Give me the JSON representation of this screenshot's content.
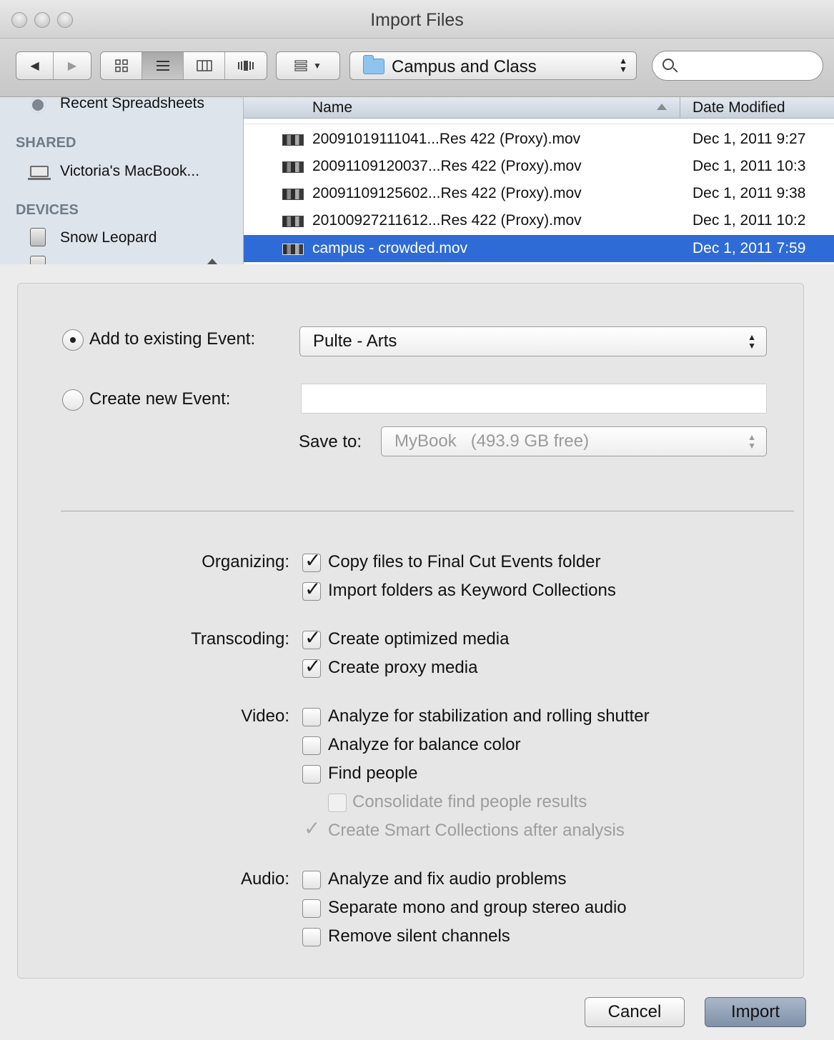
{
  "window": {
    "title": "Import Files"
  },
  "toolbar": {
    "back_icon": "back-arrow-icon",
    "forward_icon": "forward-arrow-icon",
    "views": [
      "icon-view",
      "list-view",
      "column-view",
      "coverflow-view"
    ],
    "active_view": "list-view",
    "location": "Campus and Class",
    "search": {
      "value": "",
      "placeholder": ""
    }
  },
  "sidebar": {
    "items": [
      {
        "label": "Recent Spreadsheets",
        "icon": "gear-icon"
      },
      {
        "label": "SHARED",
        "type": "header"
      },
      {
        "label": "Victoria's MacBook...",
        "icon": "laptop-icon"
      },
      {
        "label": "DEVICES",
        "type": "header"
      },
      {
        "label": "Snow Leopard",
        "icon": "hard-disk-icon"
      }
    ]
  },
  "filelist": {
    "columns": [
      "Name",
      "Date Modified"
    ],
    "rows": [
      {
        "name": "20091019111041...Res 422 (Proxy).mov",
        "date": "Dec 1, 2011 9:27",
        "selected": false
      },
      {
        "name": "20091109120037...Res 422 (Proxy).mov",
        "date": "Dec 1, 2011 10:3",
        "selected": false
      },
      {
        "name": "20091109125602...Res 422 (Proxy).mov",
        "date": "Dec 1, 2011 9:38",
        "selected": false
      },
      {
        "name": "20100927211612...Res 422 (Proxy).mov",
        "date": "Dec 1, 2011 10:2",
        "selected": false
      },
      {
        "name": "campus - crowded.mov",
        "date": "Dec 1, 2011 7:59",
        "selected": true
      }
    ]
  },
  "event": {
    "existing_label": "Add to existing Event:",
    "existing_value": "Pulte - Arts",
    "existing_selected": true,
    "new_label": "Create new Event:",
    "new_value": "",
    "save_to_label": "Save to:",
    "save_to_value": "MyBook   (493.9 GB free)"
  },
  "options": {
    "organizing": {
      "label": "Organizing:",
      "items": [
        {
          "label": "Copy files to Final Cut Events folder",
          "checked": true
        },
        {
          "label": "Import folders as Keyword Collections",
          "checked": true
        }
      ]
    },
    "transcoding": {
      "label": "Transcoding:",
      "items": [
        {
          "label": "Create optimized media",
          "checked": true
        },
        {
          "label": "Create proxy media",
          "checked": true
        }
      ]
    },
    "video": {
      "label": "Video:",
      "items": [
        {
          "label": "Analyze for stabilization and rolling shutter",
          "checked": false
        },
        {
          "label": "Analyze for balance color",
          "checked": false
        },
        {
          "label": "Find people",
          "checked": false
        },
        {
          "label": "Consolidate find people results",
          "checked": false,
          "disabled": true
        },
        {
          "label": "Create Smart Collections after analysis",
          "checked": true,
          "disabled": true
        }
      ]
    },
    "audio": {
      "label": "Audio:",
      "items": [
        {
          "label": "Analyze and fix audio problems",
          "checked": false
        },
        {
          "label": "Separate mono and group stereo audio",
          "checked": false
        },
        {
          "label": "Remove silent channels",
          "checked": false
        }
      ]
    }
  },
  "buttons": {
    "cancel": "Cancel",
    "import": "Import"
  },
  "colors": {
    "selection": "#2f6bd6",
    "sidebar_bg": "#dde4ec",
    "primary_button": "#8c9db2"
  }
}
